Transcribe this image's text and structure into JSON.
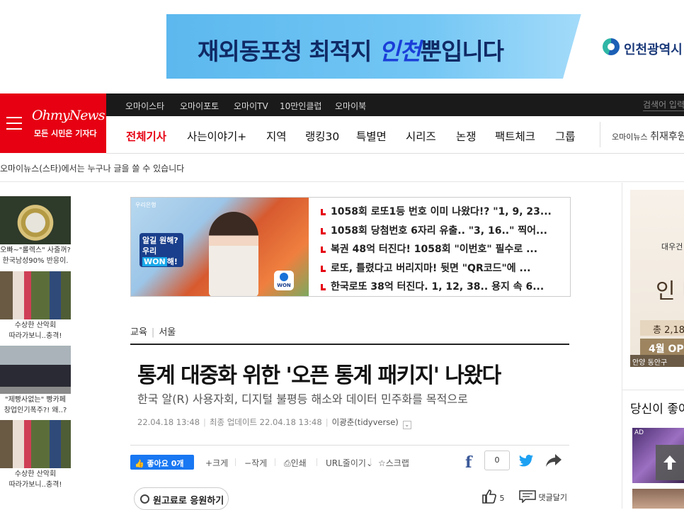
{
  "top_banner": {
    "slogan_pre": "재외동포청 최적지 ",
    "slogan_highlight": "인천",
    "slogan_post": "뿐입니다",
    "logo_text": "인천광역시",
    "colors": {
      "bg": "#6fc3f0",
      "text": "#102a66"
    }
  },
  "brand": {
    "name": "OhmyNews",
    "tagline": "모든 시민은 기자다",
    "color": "#e60012"
  },
  "top_nav": {
    "items": [
      "오마이스타",
      "오마이포토",
      "오마이TV",
      "10만인클럽",
      "오마이북"
    ],
    "search_placeholder": "검색어 입력"
  },
  "main_nav": {
    "items": [
      "전체기사",
      "사는이야기+",
      "지역",
      "랭킹30",
      "특별면",
      "시리즈",
      "논쟁",
      "팩트체크",
      "그룹"
    ],
    "active_index": 0,
    "promo_small": "오마이뉴스",
    "promo_big": "취재후원"
  },
  "subline": "오마이뉴스(스타)에서는 누구나 글을 쓸 수 있습니다",
  "left_thumbs": [
    {
      "caption1": "오빠~\"롤렉스\" 사줄꺼?",
      "caption2": "한국남성90% 반응이."
    },
    {
      "caption1": "수상한 산악회",
      "caption2": "따라가보니..충격!"
    },
    {
      "caption1": "\"제빵사없는\" 빵카페",
      "caption2": "창업인기폭주?! 왜..?"
    },
    {
      "caption1": "수상한 산악회",
      "caption2": "따라가보니..충격!"
    }
  ],
  "ad_box": {
    "bank_label": "우리은행",
    "sign_line1": "알길 원해?",
    "sign_line2_pre": "우리 ",
    "sign_won": "WON",
    "sign_line2_post": "해!",
    "app_label": "WON",
    "headlines": [
      "1058회 로또1등 번호 이미 나왔다!? \"1, 9, 23...",
      "1058회 당첨번호 6자리 유출.. \"3, 16..\" 찍어...",
      "복권 48억 터진다! 1058회 \"이번호\" 필수로 ...",
      "로또, 틀렸다고 버리지마! 뒷면 \"QR코드\"에 ...",
      "한국로또 38억 터진다. 1, 12, 38.. 용지 속 6..."
    ]
  },
  "article": {
    "breadcrumb": [
      "교육",
      "서울"
    ],
    "headline": "통계 대중화 위한 '오픈 통계 패키지' 나왔다",
    "subhead": "한국 알(R) 사용자회, 디지털 불평등 해소와 데이터 민주화를 목적으로",
    "published": "22.04.18 13:48",
    "updated_label": "최종 업데이트 22.04.18 13:48",
    "author": "이광춘(tidyverse)"
  },
  "toolbar": {
    "like_label": "좋아요 0개",
    "font_up": "크게",
    "font_down": "작게",
    "print": "인쇄",
    "short_url": "URL줄이기",
    "scrap": "스크랩",
    "share_count": "0"
  },
  "support_label": "원고료로 응원하기",
  "likes_count": "5",
  "comment_label": "댓글달기",
  "right_ad": {
    "t1": "대우건",
    "t2": "인 더",
    "band1": "총 2,18",
    "band2": "4월 OP",
    "loc": "안양 동안구"
  },
  "recommend_title": "당신이 좋아",
  "right_thumb_ad": "AD"
}
